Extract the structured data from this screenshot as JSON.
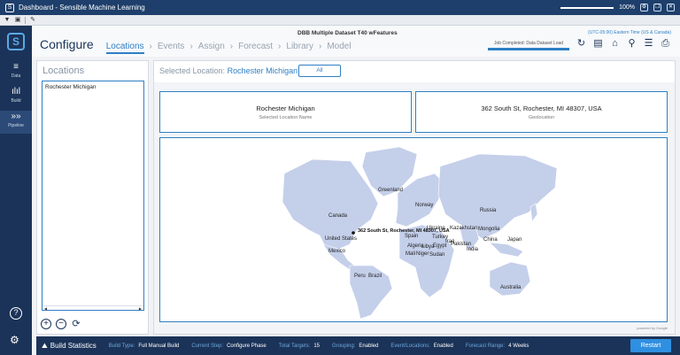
{
  "window": {
    "title": "Dashboard - Sensible Machine Learning",
    "zoom": "100%",
    "zoom_fraction": 1.0
  },
  "rail": {
    "items": [
      {
        "label": "Data",
        "icon": "database-icon"
      },
      {
        "label": "Build",
        "icon": "waveform-icon"
      },
      {
        "label": "Pipeline",
        "icon": "pipeline-icon"
      }
    ]
  },
  "header": {
    "title": "Configure",
    "steps": [
      "Locations",
      "Events",
      "Assign",
      "Forecast",
      "Library",
      "Model"
    ],
    "active_step": "Locations",
    "dataset": "DBB Multiple Dataset T40 wFeatures",
    "job_status": "Job Completed: Data Dataset Load",
    "timezone": "(UTC-05:00) Eastern Time (US & Canada)",
    "icons": [
      "refresh-icon",
      "document-icon",
      "home-icon",
      "chart-search-icon",
      "database-icon",
      "export-icon"
    ]
  },
  "locations_panel": {
    "title": "Locations",
    "items": [
      "Rochester Michigan"
    ]
  },
  "main": {
    "selected_label": "Selected Location:",
    "selected_value": "Rochester Michigan",
    "all_button": "All",
    "card_name": {
      "value": "Rochester Michigan",
      "label": "Selected Location Name"
    },
    "card_geo": {
      "value": "362 South St, Rochester, MI 48307, USA",
      "label": "Geolocation"
    },
    "map_labels": {
      "greenland": "Greenland",
      "canada": "Canada",
      "united_states": "United States",
      "mexico": "Mexico",
      "peru": "Peru",
      "brazil": "Brazil",
      "norway": "Norway",
      "russia": "Russia",
      "ukraine": "Ukraine",
      "kazakhstan": "Kazakhstan",
      "mongolia": "Mongolia",
      "spain": "Spain",
      "turkey": "Turkey",
      "iraq": "Iraq",
      "china": "China",
      "japan": "Japan",
      "algeria": "Algeria",
      "libya": "Libya",
      "egypt": "Egypt",
      "pakistan": "Pakistan",
      "india": "India",
      "mali": "Mali",
      "niger": "Niger",
      "sudan": "Sudan",
      "australia": "Australia",
      "pin": "362 South St, Rochester, MI 48307, USA"
    },
    "powered_by": "powered by Google"
  },
  "status": {
    "title": "Build Statistics",
    "fields": [
      {
        "key": "Build Type:",
        "value": "Full Manual Build"
      },
      {
        "key": "Current Step:",
        "value": "Configure Phase"
      },
      {
        "key": "Total Targets:",
        "value": "15"
      },
      {
        "key": "Grouping:",
        "value": "Enabled"
      },
      {
        "key": "Event/Locations:",
        "value": "Enabled"
      },
      {
        "key": "Forecast Range:",
        "value": "4 Weeks"
      }
    ],
    "restart_label": "Restart"
  }
}
